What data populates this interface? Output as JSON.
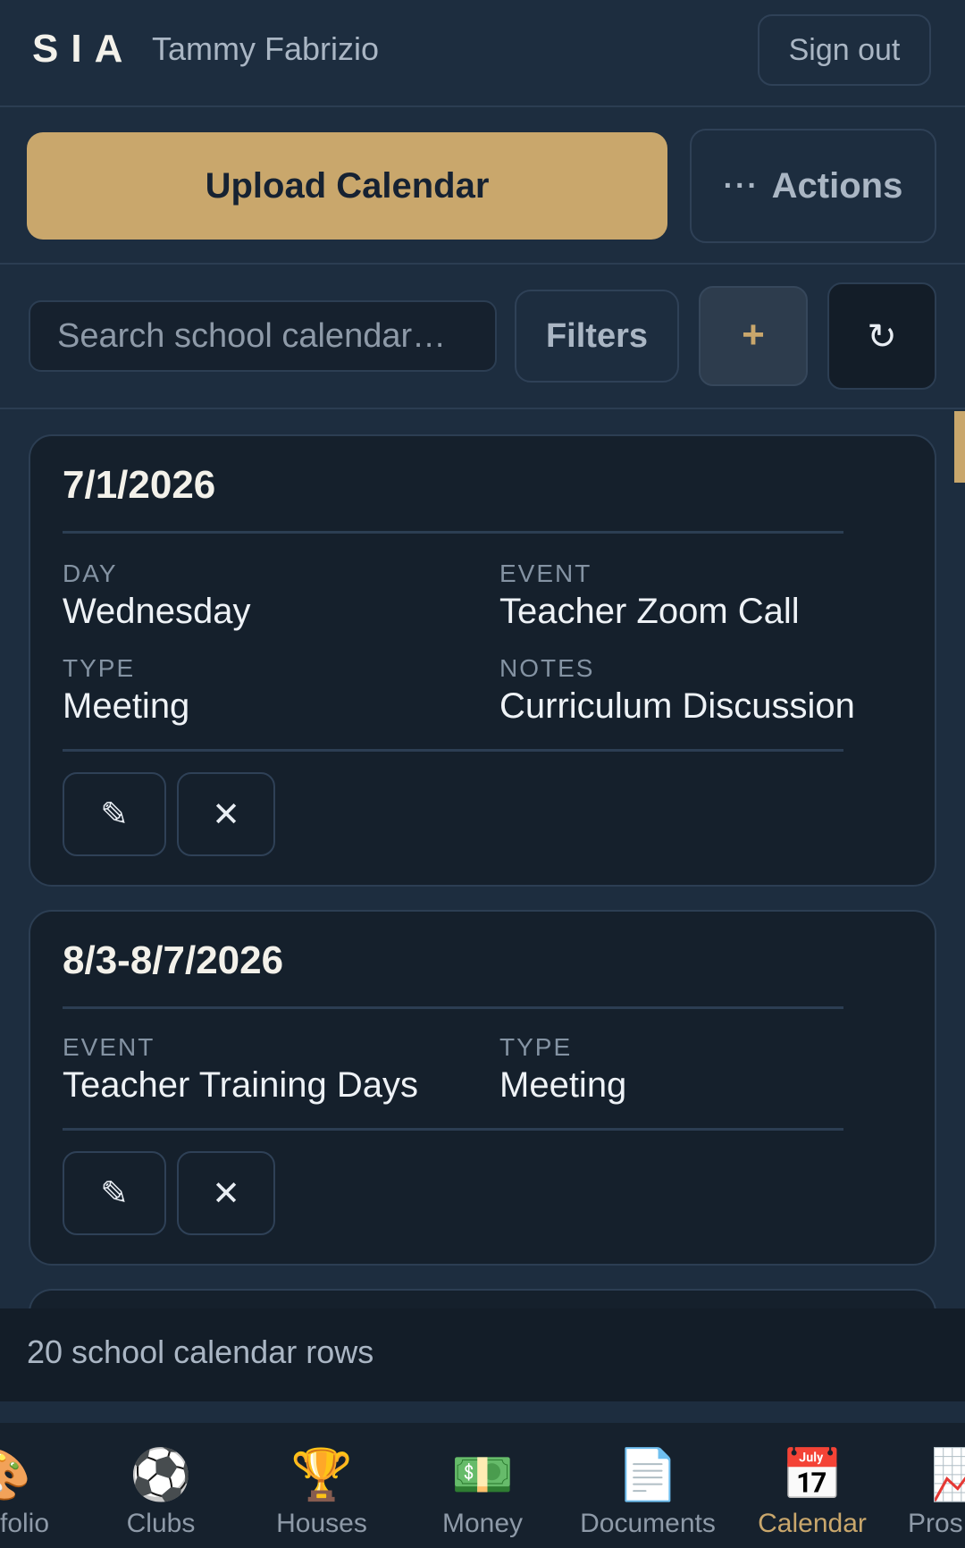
{
  "header": {
    "logo": "SIA",
    "user_name": "Tammy Fabrizio",
    "sign_out_label": "Sign out"
  },
  "action_bar": {
    "upload_label": "Upload Calendar",
    "actions_dots": "···",
    "actions_label": "Actions"
  },
  "toolbar": {
    "search_placeholder": "Search school calendar…",
    "filters_label": "Filters",
    "add_symbol": "+",
    "refresh_symbol": "↻"
  },
  "cards": [
    {
      "date": "7/1/2026",
      "fields": [
        {
          "label": "DAY",
          "value": "Wednesday"
        },
        {
          "label": "EVENT",
          "value": "Teacher Zoom Call"
        },
        {
          "label": "TYPE",
          "value": "Meeting"
        },
        {
          "label": "NOTES",
          "value": "Curriculum Discussion"
        }
      ],
      "edit_symbol": "✎",
      "delete_symbol": "✕"
    },
    {
      "date": "8/3-8/7/2026",
      "fields": [
        {
          "label": "EVENT",
          "value": "Teacher Training Days"
        },
        {
          "label": "TYPE",
          "value": "Meeting"
        }
      ],
      "edit_symbol": "✎",
      "delete_symbol": "✕"
    }
  ],
  "footer": {
    "row_count_text": "20 school calendar rows"
  },
  "nav": {
    "items": [
      {
        "label": "folio",
        "icon": "🎨"
      },
      {
        "label": "Clubs",
        "icon": "⚽"
      },
      {
        "label": "Houses",
        "icon": "🏆"
      },
      {
        "label": "Money",
        "icon": "💵"
      },
      {
        "label": "Documents",
        "icon": "📄"
      },
      {
        "label": "Calendar",
        "icon": "📅"
      },
      {
        "label": "Pros",
        "icon": "📈"
      }
    ],
    "active": "Calendar"
  },
  "colors": {
    "background": "#1d2d3f",
    "accent": "#c9a76c",
    "card": "#15202c"
  }
}
